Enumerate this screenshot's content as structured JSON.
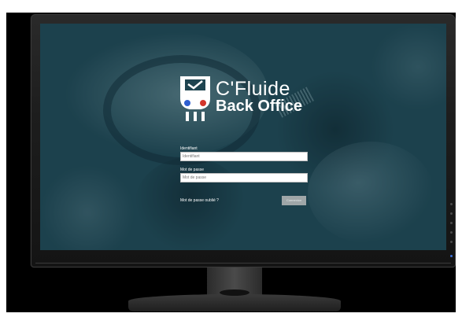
{
  "brand": {
    "title": "C'Fluide",
    "subtitle": "Back Office"
  },
  "login": {
    "username_label": "Identifiant",
    "username_placeholder": "Identifiant",
    "password_label": "Mot de passe",
    "password_placeholder": "Mot de passe",
    "forgot_password": "Mot de passe oublié ?",
    "submit_label": "Connexion"
  },
  "colors": {
    "screen_background": "#1e4450",
    "form_text": "#ffffff",
    "button": "#9fa6a8",
    "logo_blue": "#2f5fd0",
    "logo_red": "#d2352b",
    "power_led": "#3b6fd9"
  },
  "icons": {
    "logo": "refrigerant-gauge-checkmark-icon",
    "power": "power-led-icon"
  }
}
